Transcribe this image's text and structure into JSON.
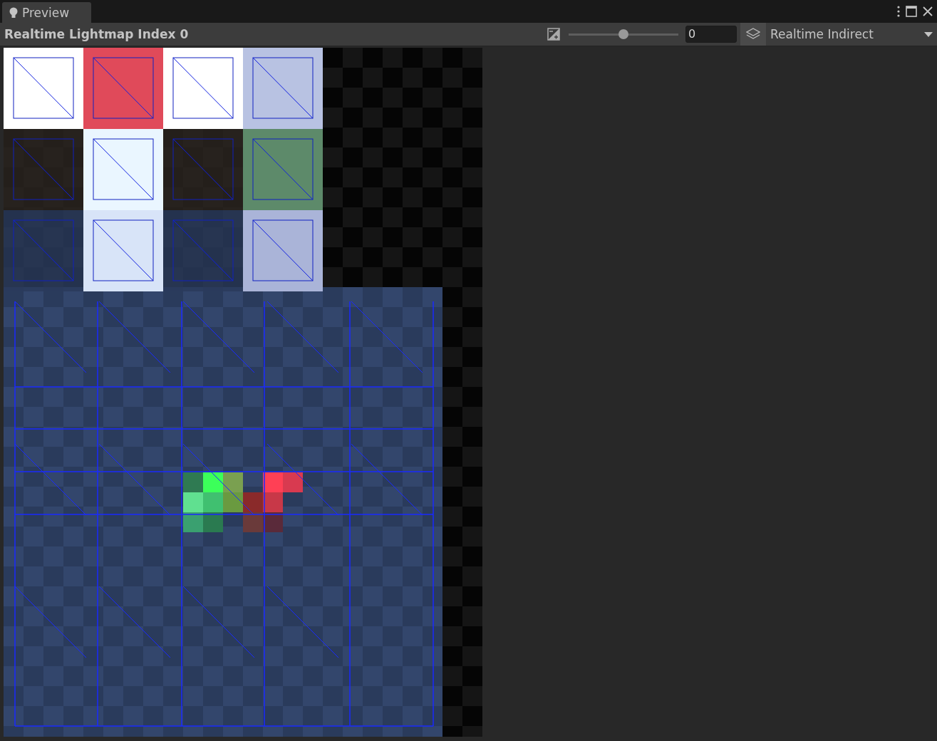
{
  "tab": {
    "title": "Preview",
    "selected": true
  },
  "toolbar": {
    "title": "Realtime Lightmap Index 0",
    "exposure": {
      "level": 0.5,
      "value": "0"
    },
    "mode": "Realtime Indirect"
  }
}
